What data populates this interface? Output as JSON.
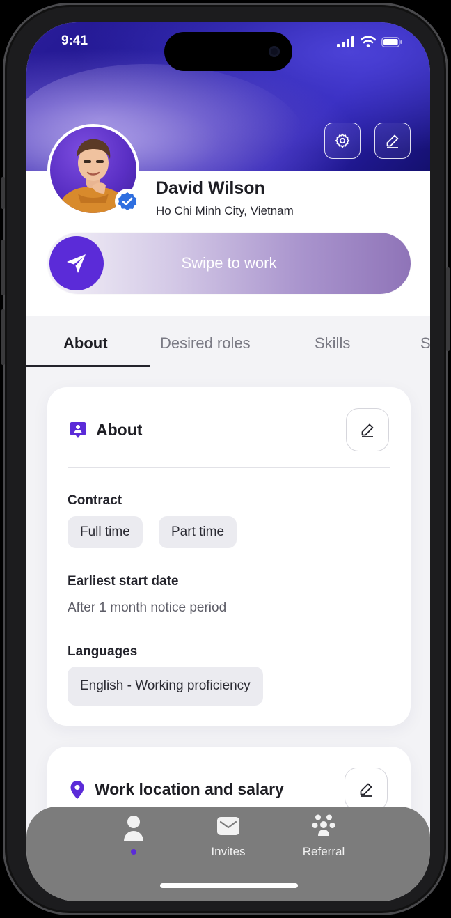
{
  "status_bar": {
    "time": "9:41"
  },
  "colors": {
    "accent": "#5b2bd8",
    "verified": "#2f6fe0",
    "nav_bg": "#7c7c7c"
  },
  "header": {
    "settings_icon": "gear-icon",
    "edit_icon": "pencil-icon"
  },
  "profile": {
    "name": "David Wilson",
    "location": "Ho Chi Minh City, Vietnam",
    "verified_icon": "verified-badge-icon"
  },
  "swipe": {
    "label": "Swipe to work",
    "icon": "paper-plane-icon"
  },
  "tabs": [
    {
      "label": "About",
      "active": true
    },
    {
      "label": "Desired roles",
      "active": false
    },
    {
      "label": "Skills",
      "active": false
    },
    {
      "label": "S",
      "active": false
    }
  ],
  "about_card": {
    "title": "About",
    "title_icon": "contact-card-icon",
    "edit_icon": "pencil-icon",
    "contract": {
      "label": "Contract",
      "options": [
        "Full time",
        "Part time"
      ]
    },
    "start_date": {
      "label": "Earliest start date",
      "value": "After 1 month notice period"
    },
    "languages": {
      "label": "Languages",
      "items": [
        "English - Working proficiency"
      ]
    }
  },
  "location_card": {
    "title": "Work location and salary",
    "title_icon": "location-pin-icon",
    "edit_icon": "pencil-icon"
  },
  "bottom_nav": {
    "items": [
      {
        "label": "",
        "icon": "person-icon",
        "active": true
      },
      {
        "label": "Invites",
        "icon": "envelope-icon",
        "active": false
      },
      {
        "label": "Referral",
        "icon": "people-group-icon",
        "active": false
      }
    ]
  }
}
